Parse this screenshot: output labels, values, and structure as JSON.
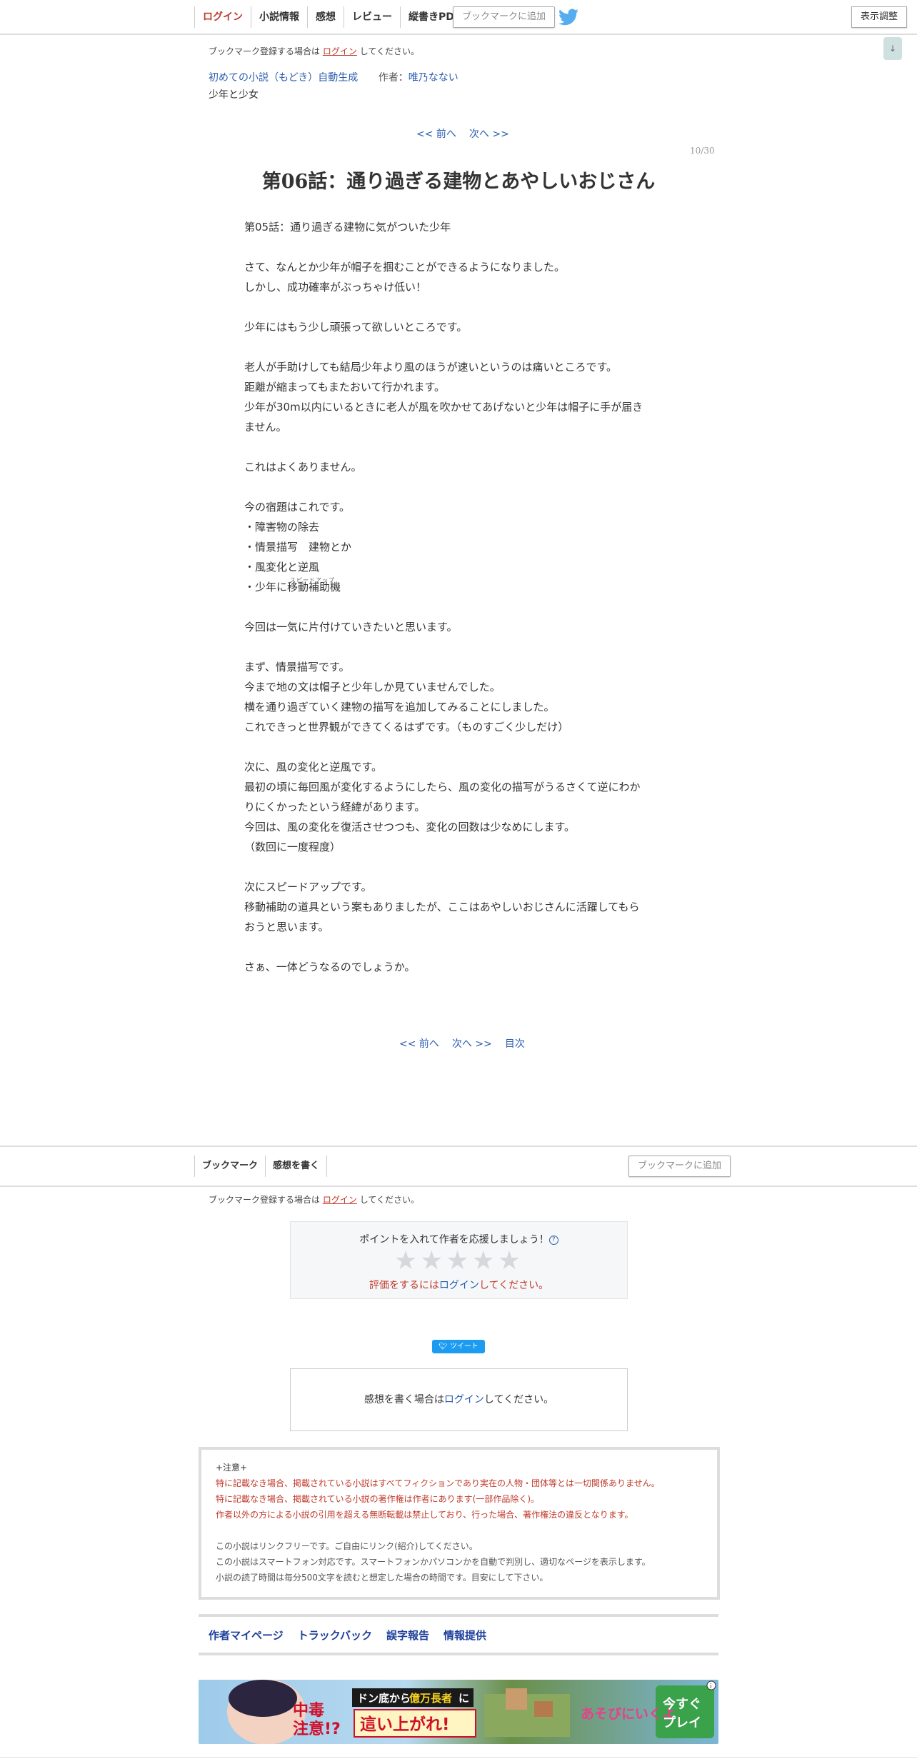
{
  "topnav": {
    "items": [
      "ログイン",
      "小説情報",
      "感想",
      "レビュー",
      "縦書きPDF"
    ],
    "bookmark_btn": "ブックマークに追加",
    "display_btn": "表示調整",
    "scroll_btn": "↓"
  },
  "bookmark_note": {
    "prefix": "ブックマーク登録する場合は",
    "login": "ログイン",
    "suffix": "してください。"
  },
  "series": {
    "title": "初めての小説（もどき）自動生成",
    "author_label": "作者：",
    "author": "唯乃なない",
    "subtitle": "少年と少女"
  },
  "pager_top": {
    "prev": "<< 前へ",
    "next": "次へ >>"
  },
  "page_num": "10/30",
  "chapter_title": "第06話：通り過ぎる建物とあやしいおじさん",
  "body_lines": [
    "第05話：通り過ぎる建物に気がついた少年",
    "",
    "さて、なんとか少年が帽子を掴むことができるようになりました。",
    "しかし、成功確率がぶっちゃけ低い！",
    "",
    "少年にはもう少し頑張って欲しいところです。",
    "",
    "老人が手助けしても結局少年より風のほうが速いというのは痛いところです。",
    "距離が縮まってもまたおいて行かれます。",
    "少年が30m以内にいるときに老人が風を吹かせてあげないと少年は帽子に手が届き",
    "ません。",
    "",
    "これはよくありません。",
    "",
    "今の宿題はこれです。",
    "・障害物の除去",
    "・情景描写　建物とか",
    "・風変化と逆風",
    "・少年に移動補助機",
    "",
    "今回は一気に片付けていきたいと思います。",
    "",
    "まず、情景描写です。",
    "今まで地の文は帽子と少年しか見ていませんでした。",
    "横を通り過ぎていく建物の描写を追加してみることにしました。",
    "これできっと世界観ができてくるはずです。（ものすごく少しだけ）",
    "",
    "次に、風の変化と逆風です。",
    "最初の頃に毎回風が変化するようにしたら、風の変化の描写がうるさくて逆にわか",
    "りにくかったという経緯があります。",
    "今回は、風の変化を復活させつつも、変化の回数は少なめにします。",
    "（数回に一度程度）",
    "",
    "次にスピードアップです。",
    "移動補助の道具という案もありましたが、ここはあやしいおじさんに活躍してもら",
    "おうと思います。",
    "",
    "さぁ、一体どうなるのでしょうか。"
  ],
  "ruby": "スピードアップ",
  "pager_bottom": {
    "prev": "<< 前へ",
    "next": "次へ >>",
    "toc": "目次"
  },
  "bar2": {
    "items": [
      "ブックマーク",
      "感想を書く"
    ],
    "bookmark_btn": "ブックマークに追加"
  },
  "rating": {
    "head": "ポイントを入れて作者を応援しましょう！",
    "help": "?",
    "stars": "★★★★★",
    "msg_prefix": "評価をするには",
    "msg_login": "ログイン",
    "msg_suffix": "してください。"
  },
  "tweet": "ツイート",
  "impression": {
    "prefix": "感想を書く場合は",
    "login": "ログイン",
    "suffix": "してください。"
  },
  "notice": {
    "head": "+注意+",
    "red_lines": [
      "特に記載なき場合、掲載されている小説はすべてフィクションであり実在の人物・団体等とは一切関係ありません。",
      "特に記載なき場合、掲載されている小説の著作権は作者にあります(一部作品除く)。",
      "作者以外の方による小説の引用を超える無断転載は禁止しており、行った場合、著作権法の違反となります。"
    ],
    "gray_lines": [
      "この小説はリンクフリーです。ご自由にリンク(紹介)してください。",
      "この小説はスマートフォン対応です。スマートフォンかパソコンかを自動で判別し、適切なページを表示します。",
      "小説の読了時間は毎分500文字を読むと想定した場合の時間です。目安にして下さい。"
    ]
  },
  "footer_links": [
    "作者マイページ",
    "トラックバック",
    "誤字報告",
    "情報提供"
  ],
  "banner": {
    "warn1": "中毒",
    "warn2": "注意!?",
    "catch1": "ドン底から",
    "catch2": "億万長者",
    "catch3": "に",
    "catch4": "這い上がれ!",
    "logo": "あそびにいくよ",
    "play1": "今すぐ",
    "play2": "プレイ",
    "info": "i"
  },
  "colors": {
    "link": "#2a5db0",
    "login_red": "#c0392b",
    "twitter": "#1d9bf0"
  }
}
